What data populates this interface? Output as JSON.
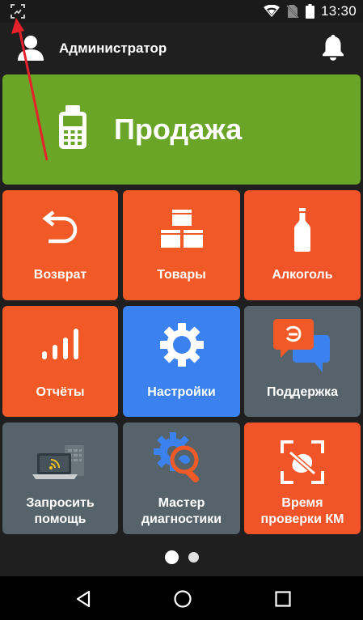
{
  "status_bar": {
    "time": "13:30",
    "icons": [
      "screenshot-icon",
      "wifi-icon",
      "no-sim-icon",
      "battery-icon"
    ]
  },
  "header": {
    "user_name": "Администратор",
    "icons": [
      "avatar-icon",
      "bell-icon"
    ]
  },
  "tiles": {
    "sale": {
      "label": "Продажа",
      "icon": "pos-terminal-icon",
      "color": "#6aa528"
    },
    "return": {
      "label": "Возврат",
      "icon": "undo-arrow-icon",
      "color": "#f15a26"
    },
    "goods": {
      "label": "Товары",
      "icon": "boxes-icon",
      "color": "#f15a26"
    },
    "alcohol": {
      "label": "Алкоголь",
      "icon": "bottle-icon",
      "color": "#f2542a"
    },
    "reports": {
      "label": "Отчёты",
      "icon": "bar-chart-icon",
      "color": "#f15a26"
    },
    "settings": {
      "label": "Настройки",
      "icon": "gear-icon",
      "color": "#3b82ee"
    },
    "support": {
      "label": "Поддержка",
      "icon": "chat-bubbles-icon",
      "color": "#57636b"
    },
    "request_help": {
      "label_line1": "Запросить",
      "label_line2": "помощь",
      "icon": "laptop-remote-icon",
      "color": "#57636b"
    },
    "diagnostics": {
      "label_line1": "Мастер",
      "label_line2": "диагностики",
      "icon": "gear-magnifier-icon",
      "color": "#57636b"
    },
    "km_time": {
      "label_line1": "Время",
      "label_line2": "проверки КМ",
      "icon": "scan-frame-icon",
      "color": "#f2542a"
    }
  },
  "pager": {
    "pages": 2,
    "current": 1
  },
  "nav_bar": {
    "icons": [
      "back-icon",
      "home-icon",
      "recents-icon"
    ]
  }
}
